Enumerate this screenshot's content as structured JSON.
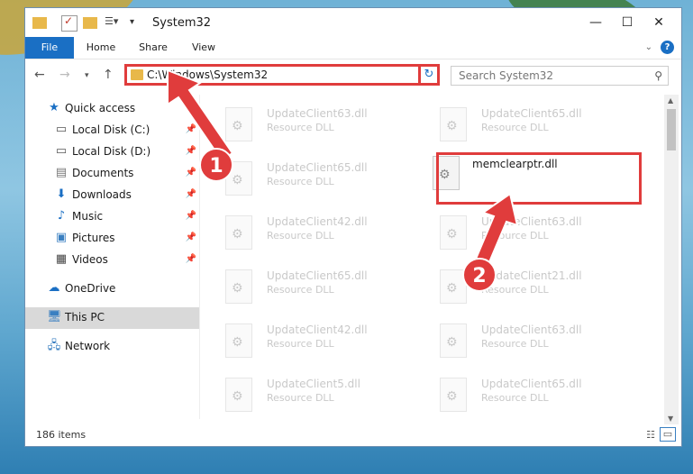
{
  "window": {
    "title": "System32"
  },
  "ribbon": {
    "tabs": [
      "File",
      "Home",
      "Share",
      "View"
    ]
  },
  "address": {
    "path": "C:\\Windows\\System32"
  },
  "search": {
    "placeholder": "Search System32"
  },
  "sidebar": {
    "items": [
      {
        "label": "Quick access",
        "icon": "star-icon",
        "pinned": false
      },
      {
        "label": "Local Disk (C:)",
        "icon": "drive-icon",
        "pinned": true
      },
      {
        "label": "Local Disk (D:)",
        "icon": "drive-icon",
        "pinned": true
      },
      {
        "label": "Documents",
        "icon": "documents-icon",
        "pinned": true
      },
      {
        "label": "Downloads",
        "icon": "download-icon",
        "pinned": true
      },
      {
        "label": "Music",
        "icon": "music-icon",
        "pinned": true
      },
      {
        "label": "Pictures",
        "icon": "pictures-icon",
        "pinned": true
      },
      {
        "label": "Videos",
        "icon": "videos-icon",
        "pinned": true
      },
      {
        "label": "OneDrive",
        "icon": "cloud-icon",
        "pinned": false
      },
      {
        "label": "This PC",
        "icon": "computer-icon",
        "pinned": false,
        "selected": true
      },
      {
        "label": "Network",
        "icon": "network-icon",
        "pinned": false
      }
    ]
  },
  "files": {
    "left_column": [
      {
        "name": "UpdateClient63.dll",
        "type": "Resource DLL"
      },
      {
        "name": "UpdateClient65.dll",
        "type": "Resource DLL"
      },
      {
        "name": "UpdateClient42.dll",
        "type": "Resource DLL"
      },
      {
        "name": "UpdateClient65.dll",
        "type": "Resource DLL"
      },
      {
        "name": "UpdateClient42.dll",
        "type": "Resource DLL"
      },
      {
        "name": "UpdateClient5.dll",
        "type": "Resource DLL"
      }
    ],
    "right_column": [
      {
        "name": "UpdateClient65.dll",
        "type": "Resource DLL"
      },
      {
        "name": "memclearptr.dll",
        "type": "",
        "highlighted": true
      },
      {
        "name": "UpdateClient63.dll",
        "type": "Resource DLL"
      },
      {
        "name": "UpdateClient21.dll",
        "type": "Resource DLL"
      },
      {
        "name": "UpdateClient63.dll",
        "type": "Resource DLL"
      },
      {
        "name": "UpdateClient65.dll",
        "type": "Resource DLL"
      }
    ]
  },
  "status": {
    "item_count": "186 items"
  },
  "annotations": {
    "step1": "1",
    "step2": "2"
  },
  "colors": {
    "accent": "#1a6fc4",
    "annotation_red": "#e03c3c"
  }
}
